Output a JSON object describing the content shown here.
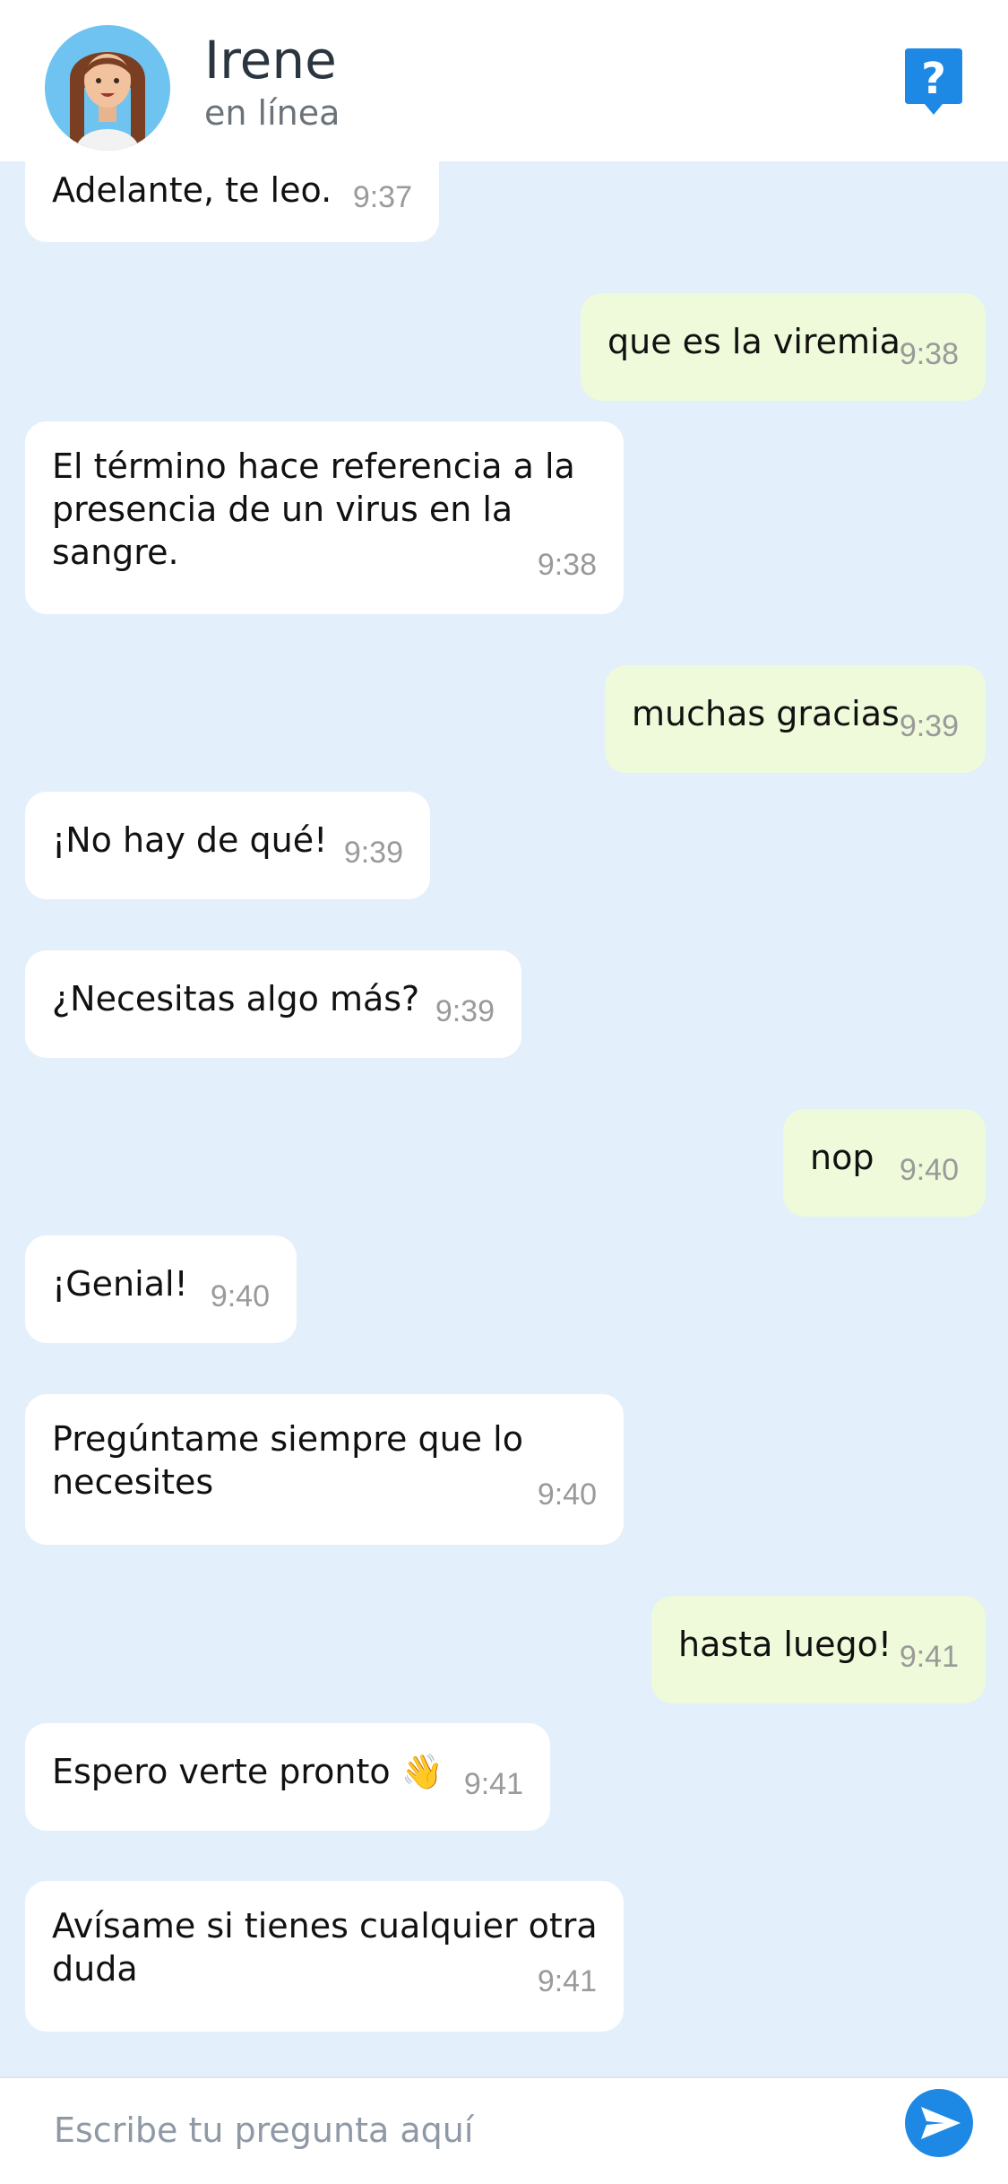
{
  "header": {
    "name": "Irene",
    "status": "en línea",
    "avatar_icon": "woman-avatar-icon",
    "help_icon": "question-chat-icon"
  },
  "messages": [
    {
      "from": "bot",
      "text": "Adelante, te leo.",
      "time": "9:37"
    },
    {
      "from": "user",
      "text": "que es la viremia",
      "time": "9:38"
    },
    {
      "from": "bot",
      "lines": [
        "El término hace referencia a la",
        "presencia de un virus en la",
        "sangre."
      ],
      "time": "9:38"
    },
    {
      "from": "user",
      "text": "muchas gracias",
      "time": "9:39"
    },
    {
      "from": "bot",
      "text": "¡No hay de qué!",
      "time": "9:39"
    },
    {
      "from": "bot",
      "text": "¿Necesitas algo más?",
      "time": "9:39"
    },
    {
      "from": "user",
      "text": "nop",
      "time": "9:40"
    },
    {
      "from": "bot",
      "text": "¡Genial!",
      "time": "9:40"
    },
    {
      "from": "bot",
      "lines": [
        "Pregúntame siempre que lo",
        "necesites"
      ],
      "time": "9:40"
    },
    {
      "from": "user",
      "text": "hasta luego!",
      "time": "9:41"
    },
    {
      "from": "bot",
      "text": "Espero verte pronto 👋",
      "time": "9:41"
    },
    {
      "from": "bot",
      "lines": [
        "Avísame si tienes cualquier otra",
        "duda"
      ],
      "time": "9:41"
    }
  ],
  "input": {
    "placeholder": "Escribe tu pregunta aquí",
    "value": ""
  },
  "colors": {
    "background": "#e3effb",
    "bot_bubble": "#ffffff",
    "user_bubble": "#eefad9",
    "accent": "#1e88e5"
  }
}
